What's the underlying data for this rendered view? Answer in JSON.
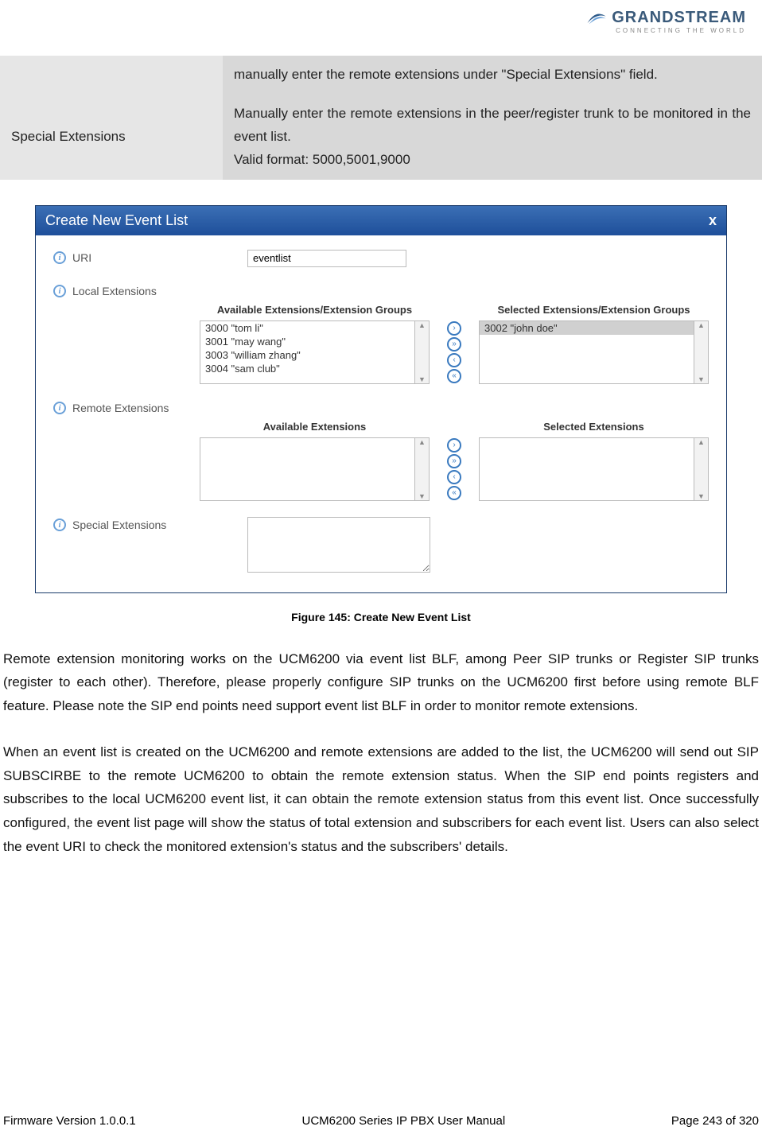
{
  "logo": {
    "brand": "GRANDSTREAM",
    "tagline": "CONNECTING THE WORLD"
  },
  "table": {
    "row1_desc": "manually enter the remote extensions under \"Special Extensions\" field.",
    "row2_label": "Special Extensions",
    "row2_desc": "Manually enter the remote extensions in the peer/register trunk to be monitored in the event list.\nValid format: 5000,5001,9000"
  },
  "dialog": {
    "title": "Create New Event List",
    "close": "x",
    "uri_label": "URI",
    "uri_value": "eventlist",
    "local_label": "Local Extensions",
    "local_avail_header": "Available Extensions/Extension Groups",
    "local_sel_header": "Selected Extensions/Extension Groups",
    "local_avail": [
      "3000 \"tom li\"",
      "3001 \"may wang\"",
      "3003 \"william zhang\"",
      "3004 \"sam club\""
    ],
    "local_sel": [
      "3002 \"john doe\""
    ],
    "remote_label": "Remote Extensions",
    "remote_avail_header": "Available Extensions",
    "remote_sel_header": "Selected Extensions",
    "special_label": "Special Extensions",
    "mover": {
      "add": "›",
      "add_all": "»",
      "remove": "‹",
      "remove_all": "«"
    }
  },
  "caption": "Figure 145: Create New Event List",
  "para1": "Remote extension monitoring works on the UCM6200 via event list BLF, among Peer SIP trunks or Register SIP trunks (register to each other). Therefore, please properly configure SIP trunks on the UCM6200 first before using remote BLF feature. Please note the SIP end points need support event list BLF in order to monitor remote extensions.",
  "para2": "When an event list is created on the UCM6200 and remote extensions are added to the list, the UCM6200 will send out SIP SUBSCIRBE to the remote UCM6200 to obtain the remote extension status. When the SIP end points registers and subscribes to the local UCM6200 event list, it can obtain the remote extension status from this event list. Once successfully configured, the event list page will show the status of total extension and subscribers for each event list. Users can also select the event URI to check the monitored extension's status and the subscribers' details.",
  "footer": {
    "left": "Firmware Version 1.0.0.1",
    "center": "UCM6200 Series IP PBX User Manual",
    "right": "Page 243 of 320"
  }
}
